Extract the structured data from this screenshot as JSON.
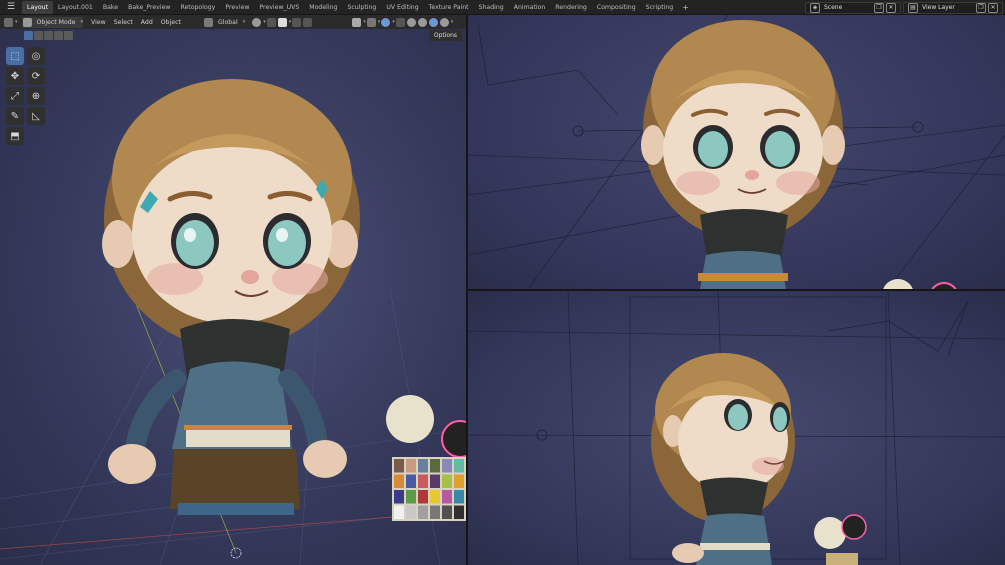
{
  "topbar": {
    "tabs": [
      "Layout",
      "Layout.001",
      "Bake",
      "Bake_Preview",
      "Retopology",
      "Preview",
      "Preview_UVS",
      "Modeling",
      "Sculpting",
      "UV Editing",
      "Texture Paint",
      "Shading",
      "Animation",
      "Rendering",
      "Compositing",
      "Scripting"
    ],
    "active_tab": "Layout",
    "add_tab": "+",
    "scene_label": "Scene",
    "view_layer_label": "View Layer"
  },
  "viewport_header": {
    "mode": "Object Mode",
    "menus": [
      "View",
      "Select",
      "Add",
      "Object"
    ],
    "transform_orientation": "Global",
    "options": "Options"
  },
  "colors": {
    "accent": "#4a6fa5",
    "viewport_bg": "#34385a",
    "header_bg": "#2b2b2b"
  },
  "tools": [
    {
      "name": "select-box-tool",
      "icon": "cursor-icon",
      "glyph": "⬚",
      "active": true
    },
    {
      "name": "cursor-tool",
      "icon": "target-icon",
      "glyph": "◎",
      "active": false
    },
    {
      "name": "move-tool",
      "icon": "move-icon",
      "glyph": "✥",
      "active": false
    },
    {
      "name": "rotate-tool",
      "icon": "rotate-icon",
      "glyph": "⟳",
      "active": false
    },
    {
      "name": "scale-tool",
      "icon": "scale-icon",
      "glyph": "⤢",
      "active": false
    },
    {
      "name": "transform-tool",
      "icon": "transform-icon",
      "glyph": "⊕",
      "active": false
    },
    {
      "name": "annotate-tool",
      "icon": "annotate-icon",
      "glyph": "✎",
      "active": false
    },
    {
      "name": "measure-tool",
      "icon": "measure-icon",
      "glyph": "◺",
      "active": false
    },
    {
      "name": "add-cube-tool",
      "icon": "cube-icon",
      "glyph": "⬒",
      "active": false
    }
  ]
}
